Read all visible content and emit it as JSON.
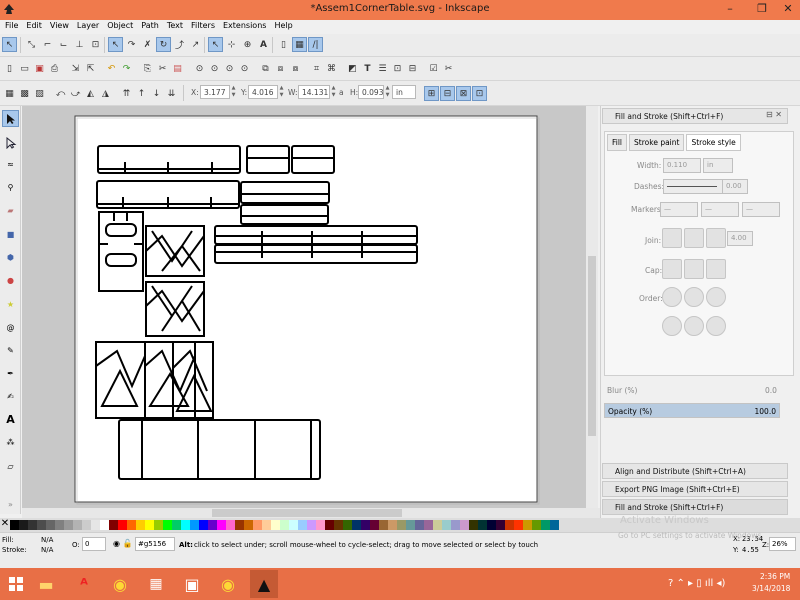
{
  "window": {
    "title": "*Assem1CornerTable.svg - Inkscape"
  },
  "menu": [
    "File",
    "Edit",
    "View",
    "Layer",
    "Object",
    "Path",
    "Text",
    "Filters",
    "Extensions",
    "Help"
  ],
  "coords": {
    "x_label": "X:",
    "x_value": "3.177",
    "y_label": "Y:",
    "y_value": "4.016",
    "w_label": "W:",
    "w_value": "14.131",
    "lock_label": "a",
    "h_label": "H:",
    "h_value": "0.093",
    "unit": "in"
  },
  "dock": {
    "title": "Fill and Stroke (Shift+Ctrl+F)",
    "tabs": {
      "fill": "Fill",
      "stroke_paint": "Stroke paint",
      "stroke_style": "Stroke style"
    },
    "width_label": "Width:",
    "width_value": "0.110",
    "width_unit": "in",
    "dashes_label": "Dashes:",
    "dashes_value": "0.00",
    "markers_label": "Markers:",
    "join_label": "Join:",
    "join_value": "4.00",
    "cap_label": "Cap:",
    "order_label": "Order:",
    "blur_label": "Blur (%)",
    "blur_value": "0.0",
    "opacity_label": "Opacity (%)",
    "opacity_value": "100.0",
    "opacity_fraction": 1.0,
    "collapsed": [
      "Align and Distribute (Shift+Ctrl+A)",
      "Export PNG Image (Shift+Ctrl+E)",
      "Fill and Stroke (Shift+Ctrl+F)"
    ]
  },
  "status": {
    "fill_label": "Fill:",
    "fill_value": "N/A",
    "stroke_label": "Stroke:",
    "stroke_value": "N/A",
    "opacity_label": "O:",
    "opacity_value": "0",
    "layer": "#g5156",
    "message_bold": "Alt:",
    "message": "click to select under; scroll mouse-wheel to cycle-select; drag to move selected or select by touch",
    "cursor_x_label": "X:",
    "cursor_x": "23.54",
    "cursor_y_label": "Y:",
    "cursor_y": "4.55",
    "zoom_label": "Z:",
    "zoom": "26%"
  },
  "watermark": {
    "line1": "Activate Windows",
    "line2": "Go to PC settings to activate Windows."
  },
  "taskbar": {
    "time": "2:36 PM",
    "date": "3/14/2018"
  },
  "palette_colors": [
    "#000000",
    "#1a1a1a",
    "#333333",
    "#4d4d4d",
    "#666666",
    "#808080",
    "#999999",
    "#b3b3b3",
    "#cccccc",
    "#e6e6e6",
    "#ffffff",
    "#800000",
    "#ff0000",
    "#ff6600",
    "#ffcc00",
    "#ffff00",
    "#99cc00",
    "#00ff00",
    "#00cc66",
    "#00ffff",
    "#0099ff",
    "#0000ff",
    "#6600cc",
    "#ff00ff",
    "#ff66cc",
    "#993300",
    "#cc6600",
    "#ff9966",
    "#ffcc99",
    "#ffffcc",
    "#ccffcc",
    "#ccffff",
    "#99ccff",
    "#cc99ff",
    "#ff99cc",
    "#660000",
    "#663300",
    "#336600",
    "#003366",
    "#330066",
    "#660033",
    "#996633",
    "#cc9966",
    "#999966",
    "#669999",
    "#666699",
    "#996699",
    "#cccc99",
    "#99cccc",
    "#9999cc",
    "#cc99cc",
    "#333300",
    "#003333",
    "#000033",
    "#330033",
    "#cc3300",
    "#ff3300",
    "#cc9900",
    "#669900",
    "#009966",
    "#006699"
  ]
}
